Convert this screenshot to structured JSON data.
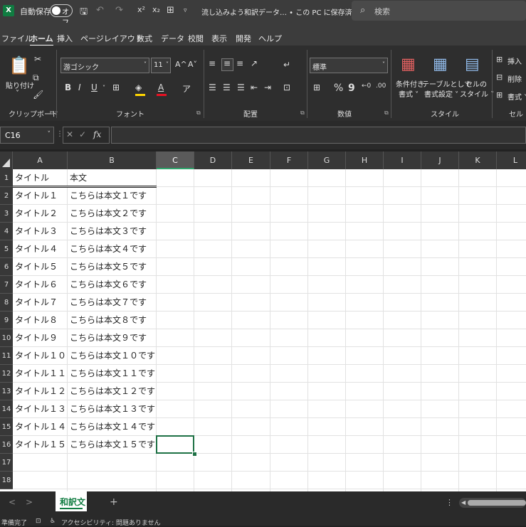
{
  "titlebar": {
    "logo": "X",
    "autosave_label": "自動保存",
    "autosave_state": "オフ",
    "doc_title": "流し込みよう和訳データ… • この PC に保存済み ∨",
    "search_placeholder": "検索"
  },
  "menu": {
    "items": [
      "ファイル",
      "ホーム",
      "挿入",
      "ページレイアウト",
      "数式",
      "データ",
      "校閲",
      "表示",
      "開発",
      "ヘルプ"
    ]
  },
  "ribbon": {
    "clipboard": {
      "paste": "貼り付け",
      "label": "クリップボード"
    },
    "font": {
      "name": "游ゴシック",
      "size": "11",
      "grow": "A^",
      "shrink": "A˅",
      "bold": "B",
      "italic": "I",
      "underline": "U",
      "label": "フォント"
    },
    "align": {
      "label": "配置"
    },
    "number": {
      "format": "標準",
      "percent": "%",
      "comma": "9",
      "label": "数値"
    },
    "styles": {
      "cond_line1": "条件付き",
      "cond_line2": "書式 ˅",
      "table_line1": "テーブルとして",
      "table_line2": "書式設定 ˅",
      "cell_line1": "セルの",
      "cell_line2": "スタイル ˅",
      "label": "スタイル"
    },
    "cells": {
      "insert": "挿入",
      "delete": "削除",
      "format": "書式 ˅",
      "label": "セル"
    }
  },
  "formula_bar": {
    "name_box": "C16",
    "fx": "fx",
    "value": ""
  },
  "columns": [
    "A",
    "B",
    "C",
    "D",
    "E",
    "F",
    "G",
    "H",
    "I",
    "J",
    "K",
    "L"
  ],
  "selected_column": "C",
  "rows": [
    {
      "num": "1",
      "a": "タイトル",
      "b": "本文"
    },
    {
      "num": "2",
      "a": "タイトル１",
      "b": "こちらは本文１です"
    },
    {
      "num": "3",
      "a": "タイトル２",
      "b": "こちらは本文２です"
    },
    {
      "num": "4",
      "a": "タイトル３",
      "b": "こちらは本文３です"
    },
    {
      "num": "5",
      "a": "タイトル４",
      "b": "こちらは本文４です"
    },
    {
      "num": "6",
      "a": "タイトル５",
      "b": "こちらは本文５です"
    },
    {
      "num": "7",
      "a": "タイトル６",
      "b": "こちらは本文６です"
    },
    {
      "num": "8",
      "a": "タイトル７",
      "b": "こちらは本文７です"
    },
    {
      "num": "9",
      "a": "タイトル８",
      "b": "こちらは本文８です"
    },
    {
      "num": "10",
      "a": "タイトル９",
      "b": "こちらは本文９です"
    },
    {
      "num": "11",
      "a": "タイトル１０",
      "b": "こちらは本文１０です"
    },
    {
      "num": "12",
      "a": "タイトル１１",
      "b": "こちらは本文１１です"
    },
    {
      "num": "13",
      "a": "タイトル１２",
      "b": "こちらは本文１２です"
    },
    {
      "num": "14",
      "a": "タイトル１３",
      "b": "こちらは本文１３です"
    },
    {
      "num": "15",
      "a": "タイトル１４",
      "b": "こちらは本文１４です"
    },
    {
      "num": "16",
      "a": "タイトル１５",
      "b": "こちらは本文１５です"
    },
    {
      "num": "17",
      "a": "",
      "b": ""
    },
    {
      "num": "18",
      "a": "",
      "b": ""
    }
  ],
  "sheets": {
    "active": "和訳文",
    "add": "+",
    "prev": "<",
    "next": ">"
  },
  "status": {
    "ready": "準備完了",
    "accessibility": "アクセシビリティ: 問題ありません"
  },
  "colors": {
    "excel_green": "#107c41",
    "selection": "#1e7145"
  }
}
